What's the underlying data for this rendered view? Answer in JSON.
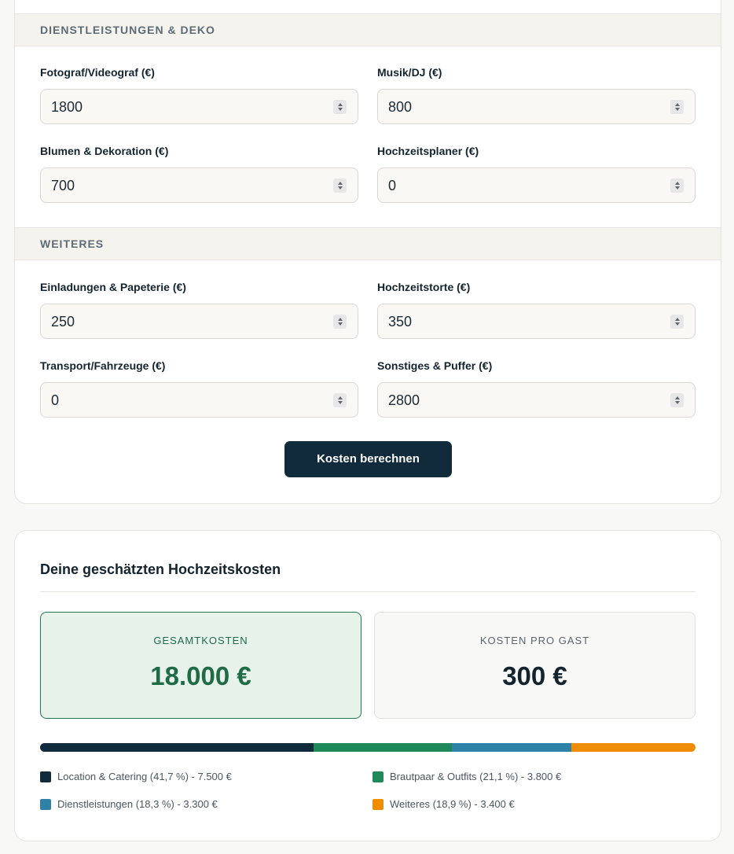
{
  "sections": {
    "services": {
      "title": "DIENSTLEISTUNGEN & DEKO",
      "fields": [
        {
          "label": "Fotograf/Videograf (€)",
          "value": "1800"
        },
        {
          "label": "Musik/DJ (€)",
          "value": "800"
        },
        {
          "label": "Blumen & Dekoration (€)",
          "value": "700"
        },
        {
          "label": "Hochzeitsplaner (€)",
          "value": "0"
        }
      ]
    },
    "more": {
      "title": "WEITERES",
      "fields": [
        {
          "label": "Einladungen & Papeterie (€)",
          "value": "250"
        },
        {
          "label": "Hochzeitstorte (€)",
          "value": "350"
        },
        {
          "label": "Transport/Fahrzeuge (€)",
          "value": "0"
        },
        {
          "label": "Sonstiges & Puffer (€)",
          "value": "2800"
        }
      ]
    }
  },
  "calculate_button": "Kosten berechnen",
  "result": {
    "title": "Deine geschätzten Hochzeitskosten",
    "total_label": "GESAMTKOSTEN",
    "total_value": "18.000 €",
    "per_guest_label": "KOSTEN PRO GAST",
    "per_guest_value": "300 €",
    "breakdown": [
      {
        "label": "Location & Catering (41,7 %) - 7.500 €",
        "percent": 41.7,
        "color": "#112b3c"
      },
      {
        "label": "Brautpaar & Outfits (21,1 %) - 3.800 €",
        "percent": 21.1,
        "color": "#1e8a5a"
      },
      {
        "label": "Dienstleistungen (18,3 %) - 3.300 €",
        "percent": 18.3,
        "color": "#2e82a8"
      },
      {
        "label": "Weiteres (18,9 %) - 3.400 €",
        "percent": 18.9,
        "color": "#f08c00"
      }
    ]
  }
}
